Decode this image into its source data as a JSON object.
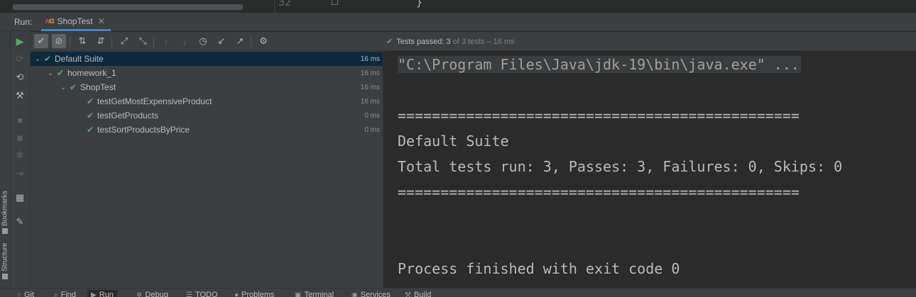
{
  "editor_peek": {
    "line_number": "32",
    "closing_brace": "}"
  },
  "run_window": {
    "label": "Run:",
    "tab": {
      "title": "ShopTest",
      "icon": "testng-icon",
      "close_glyph": "✕"
    }
  },
  "toolbar": {
    "status": {
      "text": "Tests passed:",
      "passed": "3",
      "of_total": "of 3 tests – 16 ms"
    }
  },
  "left_tool_tabs": [
    "Bookmarks",
    "Structure"
  ],
  "test_tree": [
    {
      "name": "Default Suite",
      "duration": "16 ms",
      "level": 0,
      "expanded": true,
      "selected": true,
      "status": "passed"
    },
    {
      "name": "homework_1",
      "duration": "16 ms",
      "level": 1,
      "expanded": true,
      "selected": false,
      "status": "passed"
    },
    {
      "name": "ShopTest",
      "duration": "16 ms",
      "level": 2,
      "expanded": true,
      "selected": false,
      "status": "passed"
    },
    {
      "name": "testGetMostExpensiveProduct",
      "duration": "16 ms",
      "level": 3,
      "expanded": false,
      "selected": false,
      "status": "passed"
    },
    {
      "name": "testGetProducts",
      "duration": "0 ms",
      "level": 3,
      "expanded": false,
      "selected": false,
      "status": "passed"
    },
    {
      "name": "testSortProductsByPrice",
      "duration": "0 ms",
      "level": 3,
      "expanded": false,
      "selected": false,
      "status": "passed"
    }
  ],
  "console": {
    "command": "\"C:\\Program Files\\Java\\jdk-19\\bin\\java.exe\" ...",
    "separator_top": "===============================================",
    "suite": "Default Suite",
    "summary": "Total tests run: 3, Passes: 3, Failures: 0, Skips: 0",
    "separator_bottom": "===============================================",
    "exit": "Process finished with exit code 0"
  },
  "bottom_tabs": [
    "Git",
    "Find",
    "Run",
    "Debug",
    "TODO",
    "Problems",
    "Terminal",
    "Services",
    "Build"
  ],
  "colors": {
    "pass": "#59a869",
    "selection": "#0d293e",
    "panel": "#3c3f41",
    "editor_bg": "#2b2b2b",
    "accent": "#4a88c7"
  }
}
